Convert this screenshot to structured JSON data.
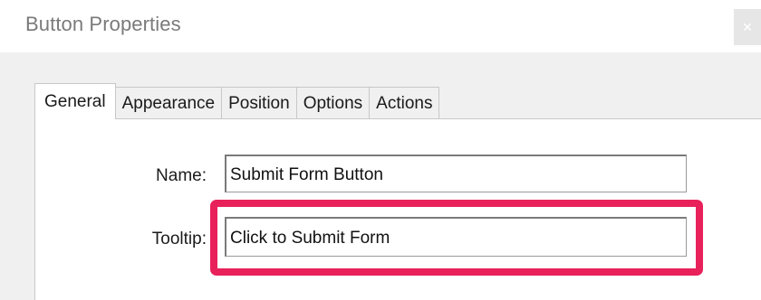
{
  "dialog": {
    "title": "Button Properties",
    "close_glyph": "✕"
  },
  "tabs": [
    {
      "label": "General",
      "active": true
    },
    {
      "label": "Appearance",
      "active": false
    },
    {
      "label": "Position",
      "active": false
    },
    {
      "label": "Options",
      "active": false
    },
    {
      "label": "Actions",
      "active": false
    }
  ],
  "general": {
    "name_label": "Name:",
    "name_value": "Submit Form Button",
    "tooltip_label": "Tooltip:",
    "tooltip_value": "Click to Submit Form"
  },
  "colors": {
    "highlight": "#e8215a",
    "title_text": "#7a7a7a",
    "dialog_bg": "#f0f0f0"
  }
}
